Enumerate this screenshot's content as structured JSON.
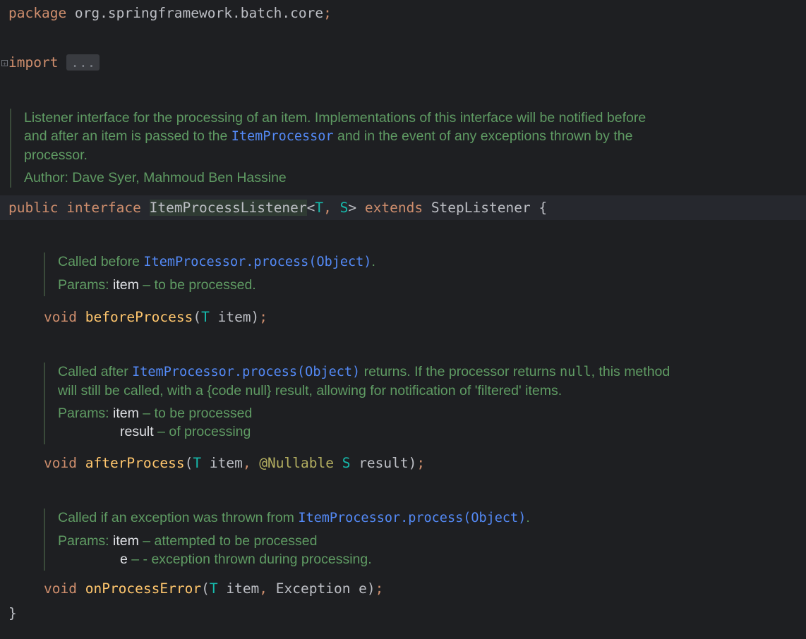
{
  "code": {
    "package_keyword": "package",
    "package_name": " org.springframework.batch.core",
    "semicolon": ";",
    "import_keyword": "import",
    "import_fold": "...",
    "class_decl": {
      "mod_public": "public",
      "mod_interface": " interface ",
      "name": "ItemProcessListener",
      "lt": "<",
      "tp1": "T",
      "comma": ", ",
      "tp2": "S",
      "gt": ">",
      "extends_kw": " extends ",
      "parent": "StepListener",
      "brace_open": " {"
    },
    "closing_brace": "}"
  },
  "class_doc": {
    "line1": "Listener interface for the processing of an item. Implementations of this interface will be notified before",
    "line2_prefix": "and after an item is passed to the ",
    "line2_link": "ItemProcessor",
    "line2_suffix": " and in the event of any exceptions thrown by the",
    "line3": "processor.",
    "author": "Author: Dave Syer, Mahmoud Ben Hassine"
  },
  "methods": [
    {
      "doc": {
        "prefix": "Called before ",
        "link": "ItemProcessor.process(Object)",
        "suffix": ".",
        "params_label": "Params: ",
        "params": [
          {
            "name": "item",
            "desc": " – to be processed."
          }
        ]
      },
      "sig": {
        "void": "void",
        "name": "beforeProcess",
        "open": "(",
        "t": "T",
        "arg": " item",
        "close": ")",
        "semi": ";"
      }
    },
    {
      "doc": {
        "prefix": "Called after ",
        "link": "ItemProcessor.process(Object)",
        "middle": " returns. If the processor returns ",
        "inline_code": "null",
        "after_code": ", this method",
        "line2": "will still be called, with a {code null} result, allowing for notification of 'filtered' items.",
        "params_label": "Params: ",
        "params": [
          {
            "name": "item",
            "desc": " – to be processed"
          },
          {
            "name": "result",
            "desc": " – of processing"
          }
        ]
      },
      "sig": {
        "void": "void",
        "name": "afterProcess",
        "open": "(",
        "t": "T",
        "arg1": " item",
        "comma": ", ",
        "annotation": "@Nullable",
        "s": " S",
        "arg2": " result",
        "close": ")",
        "semi": ";"
      }
    },
    {
      "doc": {
        "prefix": "Called if an exception was thrown from ",
        "link": "ItemProcessor.process(Object)",
        "suffix": ".",
        "params_label": "Params: ",
        "params": [
          {
            "name": "item",
            "desc": " – attempted to be processed"
          },
          {
            "name": "e",
            "desc": " – - exception thrown during processing."
          }
        ]
      },
      "sig": {
        "void": "void",
        "name": "onProcessError",
        "open": "(",
        "t": "T",
        "arg1": " item",
        "comma": ", ",
        "exc": "Exception e",
        "close": ")",
        "semi": ";"
      }
    }
  ],
  "colors": {
    "background": "#1e1f22",
    "keyword": "#cf8e6d",
    "doc_text": "#5f9b63",
    "doc_link": "#548af7",
    "method_decl": "#ffc66d",
    "type_param": "#16baac",
    "annotation": "#b3ae60"
  },
  "icons": {
    "fold_marker": "fold-expand-icon"
  }
}
